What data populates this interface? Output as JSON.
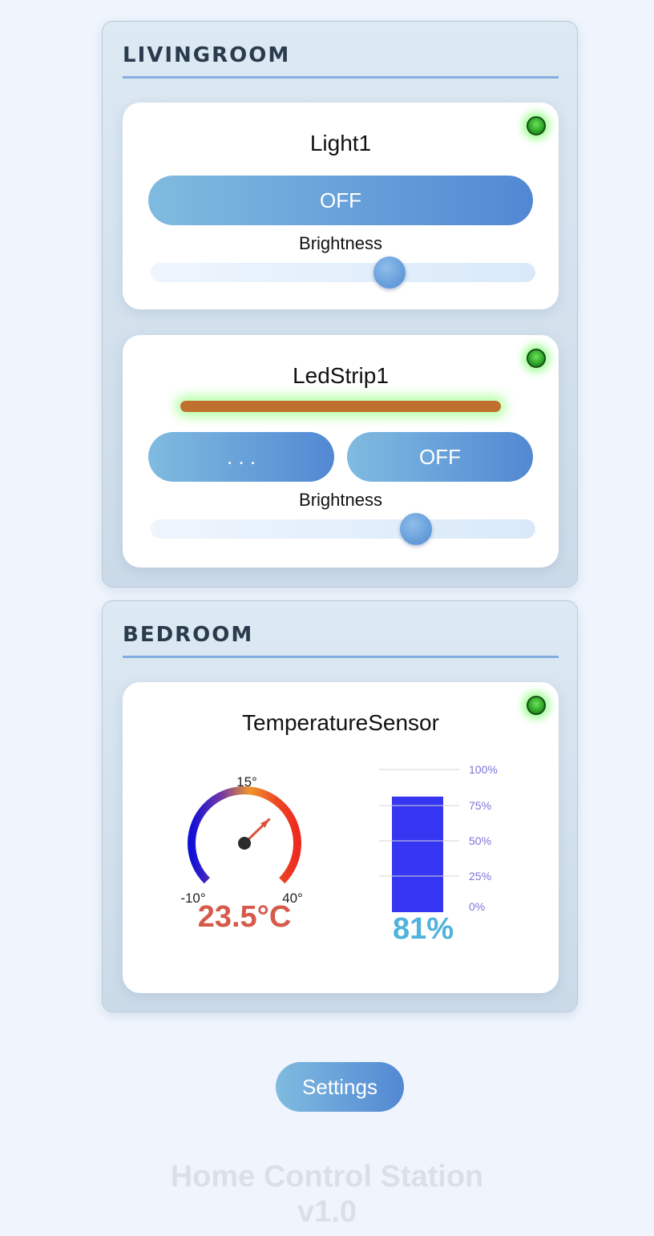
{
  "rooms": [
    {
      "title": "LIVINGROOM",
      "devices": [
        {
          "name": "Light1",
          "status": "online",
          "toggle_label": "OFF",
          "brightness_label": "Brightness",
          "brightness": 0.62
        },
        {
          "name": "LedStrip1",
          "status": "online",
          "color_button_label": ". . .",
          "toggle_label": "OFF",
          "brightness_label": "Brightness",
          "brightness": 0.69,
          "strip_color": "#c0702e"
        }
      ]
    },
    {
      "title": "BEDROOM",
      "devices": [
        {
          "name": "TemperatureSensor",
          "status": "online",
          "temperature": {
            "min_label": "-10°",
            "mid_label": "15°",
            "max_label": "40°",
            "min": -10,
            "max": 40,
            "value": 23.5,
            "value_label": "23.5°C",
            "value_color": "#d55a4a"
          },
          "humidity": {
            "ticks": [
              "100%",
              "75%",
              "50%",
              "25%",
              "0%"
            ],
            "value": 81,
            "value_label": "81%",
            "value_color": "#4fb3dc",
            "bar_color": "#2f2ff2"
          }
        }
      ]
    }
  ],
  "settings_label": "Settings",
  "footer": {
    "line1": "Home Control Station",
    "line2": "v1.0"
  }
}
